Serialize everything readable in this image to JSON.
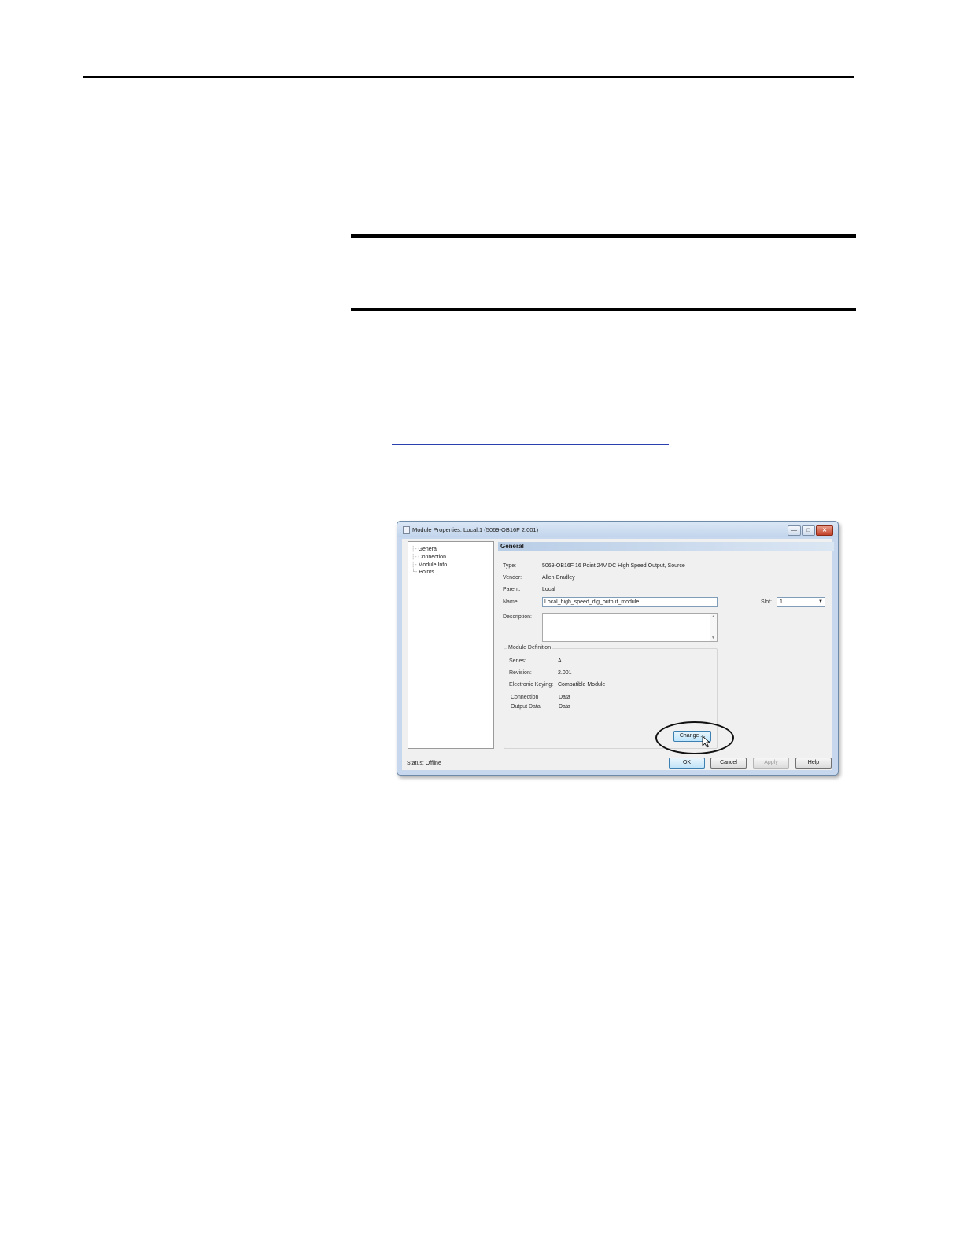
{
  "dialog": {
    "title": "Module Properties: Local:1 (5069-OB16F 2.001)",
    "window_buttons": {
      "minimize": "—",
      "maximize": "□",
      "close": "✕"
    },
    "tree": {
      "items": [
        {
          "label": "General"
        },
        {
          "label": "Connection"
        },
        {
          "label": "Module Info"
        },
        {
          "label": "Points"
        }
      ]
    },
    "section_title": "General",
    "fields": {
      "type_label": "Type:",
      "type_value": "5069-OB16F 16 Point 24V DC High Speed Output, Source",
      "vendor_label": "Vendor:",
      "vendor_value": "Allen-Bradley",
      "parent_label": "Parent:",
      "parent_value": "Local",
      "name_label": "Name:",
      "name_value": "Local_high_speed_dig_output_module",
      "description_label": "Description:",
      "description_value": "",
      "slot_label": "Slot:",
      "slot_value": "1"
    },
    "module_definition": {
      "legend": "Module Definition",
      "series_label": "Series:",
      "series_value": "A",
      "revision_label": "Revision:",
      "revision_value": "2.001",
      "keying_label": "Electronic Keying:",
      "keying_value": "Compatible Module",
      "connection_label": "Connection",
      "connection_value": "Data",
      "output_data_label": "Output Data",
      "output_data_value": "Data",
      "change_button": "Change ..."
    },
    "status": "Status:  Offline",
    "buttons": {
      "ok": "OK",
      "cancel": "Cancel",
      "apply": "Apply",
      "help": "Help"
    }
  }
}
